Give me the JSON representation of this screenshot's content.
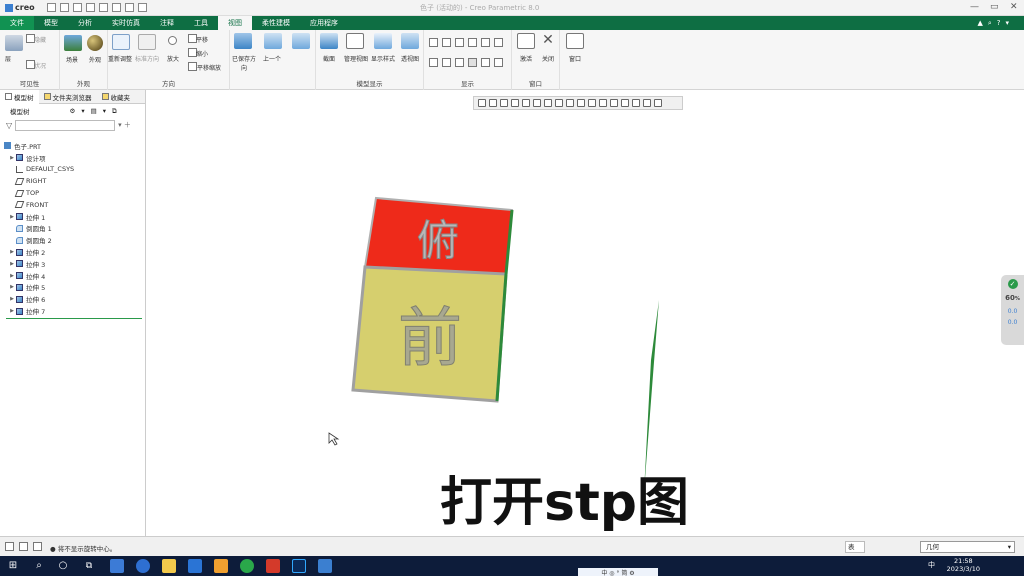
{
  "app": {
    "logo": "creo",
    "title": "色子 (活动的) - Creo Parametric 8.0"
  },
  "tabs": [
    "文件",
    "模型",
    "分析",
    "实时仿真",
    "注释",
    "工具",
    "视图",
    "柔性建模",
    "应用程序"
  ],
  "active_tab": "视图",
  "ribbon": {
    "groups": [
      {
        "label": "可见性",
        "buttons": [
          "层",
          "隐藏",
          "状况"
        ]
      },
      {
        "label": "外观",
        "buttons": [
          "场景",
          "外观"
        ]
      },
      {
        "label": "方向",
        "buttons": [
          "重新调整",
          "标准方向",
          "放大",
          "平移",
          "缩小",
          "平移缩放",
          "已保存方向",
          "上一个"
        ]
      },
      {
        "label": "模型显示",
        "buttons": [
          "截面",
          "管理视图",
          "显示样式",
          "透视图"
        ]
      },
      {
        "label": "显示",
        "buttons": []
      },
      {
        "label": "窗口",
        "buttons": [
          "激活",
          "关闭",
          "窗口"
        ]
      }
    ]
  },
  "left_panel": {
    "tabs": [
      "模型树",
      "文件夹浏览器",
      "收藏夹"
    ],
    "tree_label": "模型树",
    "items": [
      {
        "label": "色子.PRT",
        "expand": false,
        "icon": "part-icon"
      },
      {
        "label": "设计项",
        "expand": true,
        "icon": "design-items-icon"
      },
      {
        "label": "DEFAULT_CSYS",
        "expand": false,
        "icon": "csys-icon"
      },
      {
        "label": "RIGHT",
        "expand": false,
        "icon": "datum-plane-icon"
      },
      {
        "label": "TOP",
        "expand": false,
        "icon": "datum-plane-icon"
      },
      {
        "label": "FRONT",
        "expand": false,
        "icon": "datum-plane-icon"
      },
      {
        "label": "拉伸 1",
        "expand": true,
        "icon": "extrude-icon"
      },
      {
        "label": "倒圆角 1",
        "expand": false,
        "icon": "round-icon"
      },
      {
        "label": "倒圆角 2",
        "expand": false,
        "icon": "round-icon"
      },
      {
        "label": "拉伸 2",
        "expand": true,
        "icon": "extrude-icon"
      },
      {
        "label": "拉伸 3",
        "expand": true,
        "icon": "extrude-icon"
      },
      {
        "label": "拉伸 4",
        "expand": true,
        "icon": "extrude-icon"
      },
      {
        "label": "拉伸 5",
        "expand": true,
        "icon": "extrude-icon"
      },
      {
        "label": "拉伸 6",
        "expand": true,
        "icon": "extrude-icon"
      },
      {
        "label": "拉伸 7",
        "expand": true,
        "icon": "extrude-icon"
      }
    ]
  },
  "model": {
    "top_face_text": "俯",
    "front_face_text": "前",
    "top_color": "#ee2a1a",
    "front_color": "#d6cf6e",
    "side_color": "#2d8a3a"
  },
  "statusbar": {
    "message": "● 将不显示旋转中心。",
    "filter_value": "几何",
    "dropdown": "表"
  },
  "caption": "打开stp图",
  "widget": {
    "value": "60",
    "unit": "%",
    "a": "0.0",
    "b": "0.0"
  },
  "taskbar": {
    "time": "21:58",
    "date": "2023/3/10",
    "ime": "中",
    "ime_bar": "中 ◎ ° 简 ⚙"
  }
}
